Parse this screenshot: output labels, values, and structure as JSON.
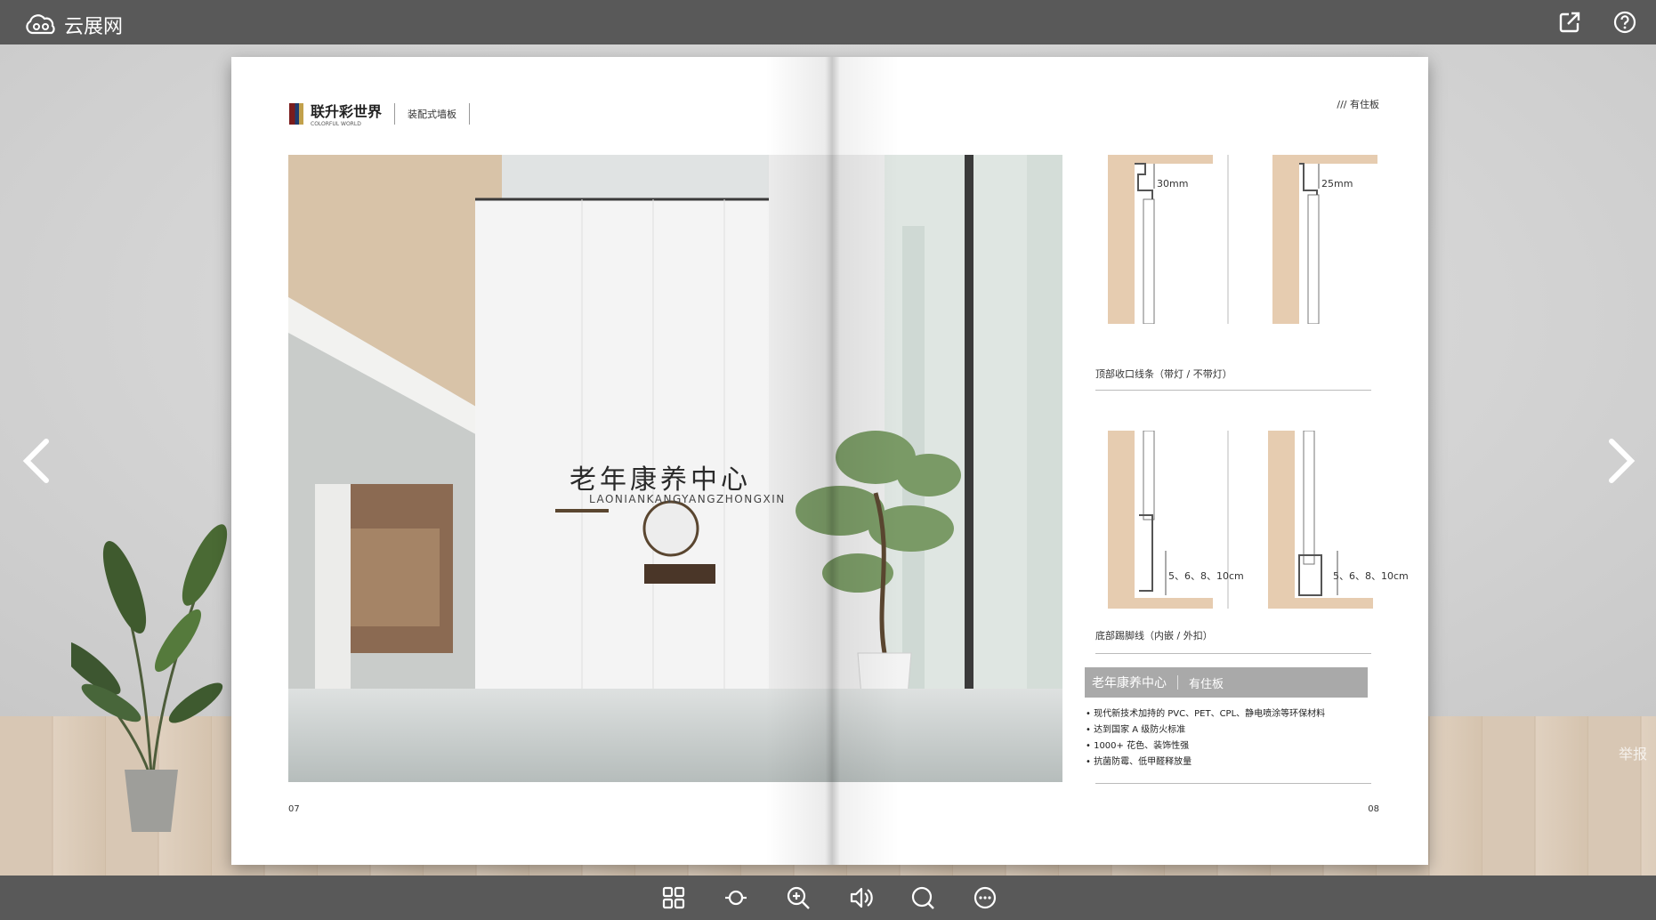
{
  "app": {
    "logo_text": "云展网",
    "share_icon": "share-icon",
    "help_icon": "help-icon"
  },
  "book": {
    "left_page": {
      "brand_name": "联升彩世界",
      "brand_sub": "COLORFUL WORLD",
      "category": "装配式墙板",
      "sign_cn": "老年康养中心",
      "sign_en": "LAONIANKANGYANGZHONGXIN",
      "page_number": "07"
    },
    "right_page": {
      "section_tag": "/// 有住板",
      "top_diagram_1_dim": "30mm",
      "top_diagram_2_dim": "25mm",
      "top_caption": "顶部收口线条（带灯 / 不带灯）",
      "bottom_diagram_1_dim": "5、6、8、10cm",
      "bottom_diagram_2_dim": "5、6、8、10cm",
      "bottom_caption": "底部踢脚线（内嵌 / 外扣）",
      "info_title": "老年康养中心",
      "info_sub": "有住板",
      "features": [
        "现代新技术加持的 PVC、PET、CPL、静电喷涂等环保材料",
        "达到国家 A 级防火标准",
        "1000+ 花色、装饰性强",
        "抗菌防霉、低甲醛释放量"
      ],
      "page_number": "08"
    }
  },
  "report_label": "举报",
  "navigation": {
    "prev_icon": "chevron-left-icon",
    "next_icon": "chevron-right-icon"
  },
  "toolbar": {
    "items": [
      "thumbnails-icon",
      "autoplay-icon",
      "zoom-in-icon",
      "sound-icon",
      "search-icon",
      "more-icon"
    ]
  }
}
